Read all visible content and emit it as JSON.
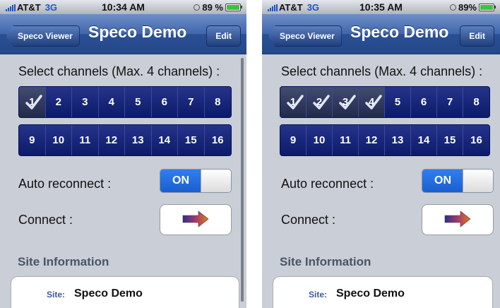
{
  "screens": [
    {
      "status": {
        "carrier": "AT&T",
        "network": "3G",
        "time": "10:34 AM",
        "battery": "89 %",
        "battery_level": 0.89
      },
      "nav": {
        "back": "Speco Viewer",
        "title": "Speco Demo",
        "edit": "Edit"
      },
      "select_label": "Select channels (Max. 4 channels) :",
      "channels_row1": [
        {
          "n": "1",
          "selected": true
        },
        {
          "n": "2",
          "selected": false
        },
        {
          "n": "3",
          "selected": false
        },
        {
          "n": "4",
          "selected": false
        },
        {
          "n": "5",
          "selected": false
        },
        {
          "n": "6",
          "selected": false
        },
        {
          "n": "7",
          "selected": false
        },
        {
          "n": "8",
          "selected": false
        }
      ],
      "channels_row2": [
        {
          "n": "9",
          "selected": false
        },
        {
          "n": "10",
          "selected": false
        },
        {
          "n": "11",
          "selected": false
        },
        {
          "n": "12",
          "selected": false
        },
        {
          "n": "13",
          "selected": false
        },
        {
          "n": "14",
          "selected": false
        },
        {
          "n": "15",
          "selected": false
        },
        {
          "n": "16",
          "selected": false
        }
      ],
      "auto_reconnect_label": "Auto reconnect :",
      "toggle_text": "ON",
      "connect_label": "Connect :",
      "site_header": "Site Information",
      "site_key": "Site:",
      "site_value": "Speco Demo",
      "scrollbar_visible": true
    },
    {
      "status": {
        "carrier": "AT&T",
        "network": "3G",
        "time": "10:35 AM",
        "battery": "89%",
        "battery_level": 0.89
      },
      "nav": {
        "back": "Speco Viewer",
        "title": "Speco Demo",
        "edit": "Edit"
      },
      "select_label": "Select channels (Max. 4 channels) :",
      "channels_row1": [
        {
          "n": "1",
          "selected": true
        },
        {
          "n": "2",
          "selected": true
        },
        {
          "n": "3",
          "selected": true
        },
        {
          "n": "4",
          "selected": true
        },
        {
          "n": "5",
          "selected": false
        },
        {
          "n": "6",
          "selected": false
        },
        {
          "n": "7",
          "selected": false
        },
        {
          "n": "8",
          "selected": false
        }
      ],
      "channels_row2": [
        {
          "n": "9",
          "selected": false
        },
        {
          "n": "10",
          "selected": false
        },
        {
          "n": "11",
          "selected": false
        },
        {
          "n": "12",
          "selected": false
        },
        {
          "n": "13",
          "selected": false
        },
        {
          "n": "14",
          "selected": false
        },
        {
          "n": "15",
          "selected": false
        },
        {
          "n": "16",
          "selected": false
        }
      ],
      "auto_reconnect_label": "Auto reconnect :",
      "toggle_text": "ON",
      "connect_label": "Connect :",
      "site_header": "Site Information",
      "site_key": "Site:",
      "site_value": "Speco Demo",
      "scrollbar_visible": false
    }
  ],
  "colors": {
    "accent_blue": "#1a5fd0",
    "channel_blue": "#0c1a6a",
    "nav_blue": "#3f66ac",
    "background": "#c9ced7"
  },
  "icons": {
    "signal": "signal-bars-icon",
    "alarm": "alarm-clock-icon",
    "battery": "battery-icon",
    "check": "checkmark-icon",
    "arrow": "right-arrow-icon"
  }
}
